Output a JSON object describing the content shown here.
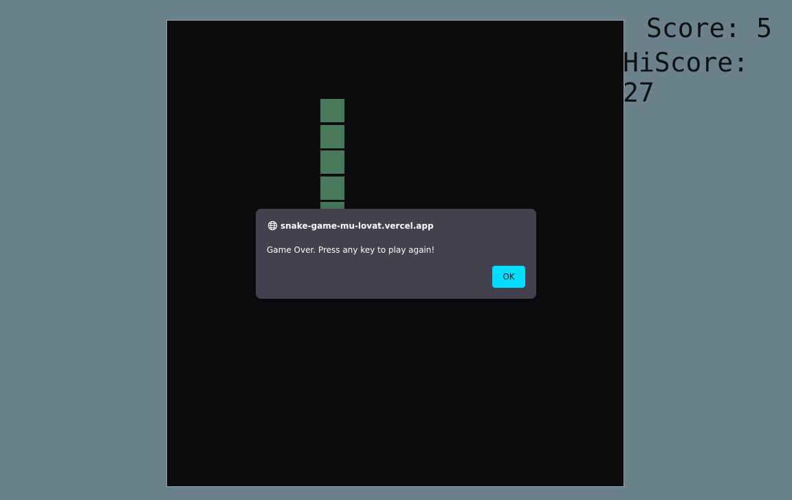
{
  "game": {
    "score_text": "Score: 5",
    "hiscore_text": "HiScore: 27",
    "score": 5,
    "hiscore": 27,
    "snake_visible_segments": 5,
    "colors": {
      "background": "#6b818c",
      "board": "#0d0d0f",
      "snake": "#487a5b"
    }
  },
  "dialog": {
    "origin": "snake-game-mu-lovat.vercel.app",
    "message": "Game Over. Press any key to play again!",
    "ok_label": "OK",
    "icon": "globe-icon",
    "button_color": "#00ddff"
  }
}
